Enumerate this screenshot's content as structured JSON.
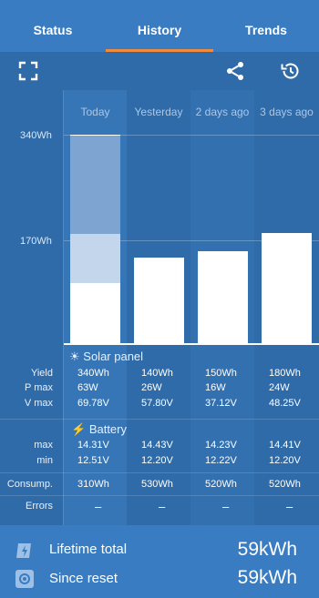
{
  "tabs": [
    {
      "label": "Status"
    },
    {
      "label": "History"
    },
    {
      "label": "Trends"
    }
  ],
  "icons": {
    "fullscreen": "fullscreen-icon",
    "share": "share-icon",
    "history": "history-icon"
  },
  "chart_data": {
    "type": "bar",
    "categories": [
      "Today",
      "Yesterday",
      "2 days ago",
      "3 days ago"
    ],
    "y_ticks": [
      "340Wh",
      "170Wh"
    ],
    "ylim": [
      0,
      340
    ],
    "values": [
      340,
      140,
      150,
      180
    ],
    "today_segments": [
      100,
      80,
      160
    ]
  },
  "table": {
    "solar_title": "Solar panel",
    "battery_title": "Battery",
    "labels": {
      "yield": "Yield",
      "pmax": "P max",
      "vmax": "V max",
      "max": "max",
      "min": "min",
      "consump": "Consump.",
      "errors": "Errors"
    },
    "columns": [
      {
        "yield": "340Wh",
        "pmax": "63W",
        "vmax": "69.78V",
        "bmax": "14.31V",
        "bmin": "12.51V",
        "consump": "310Wh",
        "errors": "–"
      },
      {
        "yield": "140Wh",
        "pmax": "26W",
        "vmax": "57.80V",
        "bmax": "14.43V",
        "bmin": "12.20V",
        "consump": "530Wh",
        "errors": "–"
      },
      {
        "yield": "150Wh",
        "pmax": "16W",
        "vmax": "37.12V",
        "bmax": "14.23V",
        "bmin": "12.22V",
        "consump": "520Wh",
        "errors": "–"
      },
      {
        "yield": "180Wh",
        "pmax": "24W",
        "vmax": "48.25V",
        "bmax": "14.41V",
        "bmin": "12.20V",
        "consump": "520Wh",
        "errors": "–"
      }
    ]
  },
  "footer": {
    "lifetime_label": "Lifetime total",
    "lifetime_value": "59kWh",
    "since_label": "Since reset",
    "since_value": "59kWh"
  },
  "colors": {
    "tabbar": "#3a7cc1",
    "accent": "#f08a3c",
    "bar": "#ffffff",
    "bar_light": "#c3d6ec",
    "bar_mid": "#7ea4d1"
  }
}
